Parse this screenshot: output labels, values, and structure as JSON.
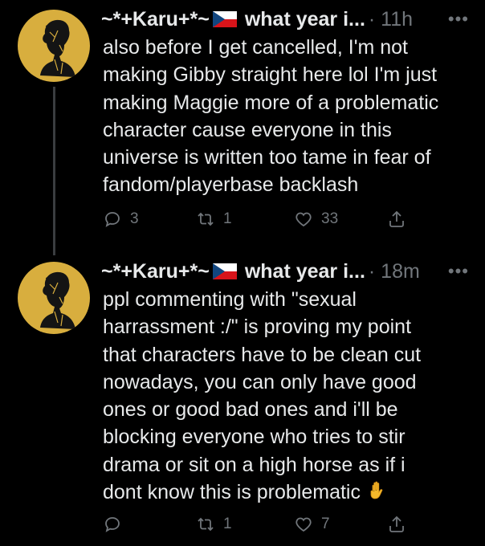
{
  "tweets": [
    {
      "display_name": "~*+Karu+*~",
      "handle_truncated": "what year i...",
      "time": "· 11h",
      "text": "also before I get cancelled, I'm not\nmaking Gibby straight here lol I'm just\nmaking Maggie more of a problematic\ncharacter cause everyone in this\nuniverse is written too tame in fear of\nfandom/playerbase backlash",
      "replies": "3",
      "retweets": "1",
      "likes": "33"
    },
    {
      "display_name": "~*+Karu+*~",
      "handle_truncated": "what year i...",
      "time": "· 18m",
      "text": "ppl commenting with \"sexual\nharrassment :/\" is proving my point\nthat characters have to be clean cut\nnowadays, you can only have good\nones or good bad ones and i'll be\nblocking everyone who tries to stir\ndrama or sit on a high horse as if i\ndont know this is problematic",
      "replies": "",
      "retweets": "1",
      "likes": "7"
    }
  ],
  "icons": {
    "menu": "more-icon",
    "flag": "czech-flag-icon",
    "emoji": "raised-hand-emoji"
  },
  "colors": {
    "background": "#000000",
    "text": "#e7e9ea",
    "secondary": "#71767b",
    "avatar_bg": "#d8ae3e"
  }
}
